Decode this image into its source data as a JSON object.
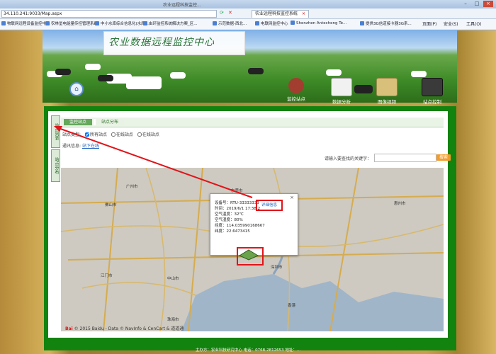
{
  "browser": {
    "window_title": "农业远程科技监控...",
    "url": "34.110.241:9033/Map.aspx",
    "tab_label": "农业远程科技监控系统",
    "favorites": [
      "物联网远程设备监控中心",
      "农林垦电能量传控管理系统",
      "中小水库综合信息化(水库...",
      "由环监控系统解决方案_区...",
      "示范数据-西北...",
      "电联网监控中心",
      "Shenzhen Antecheng Te...",
      "提供3G信道接卡器3G系..."
    ],
    "tools": [
      "页面(P)",
      "安全(S)",
      "工具(O)"
    ]
  },
  "header": {
    "title_calligraphy": "农业数据远程监控中心",
    "nav": [
      {
        "label": "监控站点",
        "color": "#a23e2f"
      },
      {
        "label": "数据分析",
        "color": "#e7e7e7"
      },
      {
        "label": "图像视频",
        "color": "#d8c07a"
      },
      {
        "label": "站点控制",
        "color": "#3a3a3a"
      }
    ]
  },
  "side_tabs": [
    "站点列表",
    "站点分布"
  ],
  "breadcrumb": [
    "监控站点",
    "站点分布"
  ],
  "filters": {
    "label": "站点类型:",
    "options": [
      {
        "label": "所有站点",
        "checked": true
      },
      {
        "label": "在线站点",
        "checked": false
      },
      {
        "label": "在线站点",
        "checked": false
      }
    ]
  },
  "status": {
    "label": "通讯信息:",
    "link": "站下在线"
  },
  "search": {
    "hint": "请输入要查找的关键字：",
    "button": "搜索"
  },
  "map": {
    "popup": {
      "device": "设备号：RTU-33333333",
      "time": "时间：2019/6/1 17:38:2",
      "temp": "空气温度：32℃",
      "humidity": "空气湿度：80%",
      "longitude": "经度：114.035990168667",
      "latitude": "纬度：22.6473415",
      "detail_link": "详细信息"
    },
    "labels": [
      "广州市",
      "佛山市",
      "东莞市",
      "深圳市",
      "江门市",
      "中山市",
      "惠州市",
      "香港",
      "珠海市"
    ],
    "attribution_brand": "Bai",
    "attribution_text": "© 2015 Baidu - Data © NavInfo & CenCart & 道道通"
  },
  "footer": "主办方：农业科技研究中心 电话：0768-2812653 地址：..."
}
